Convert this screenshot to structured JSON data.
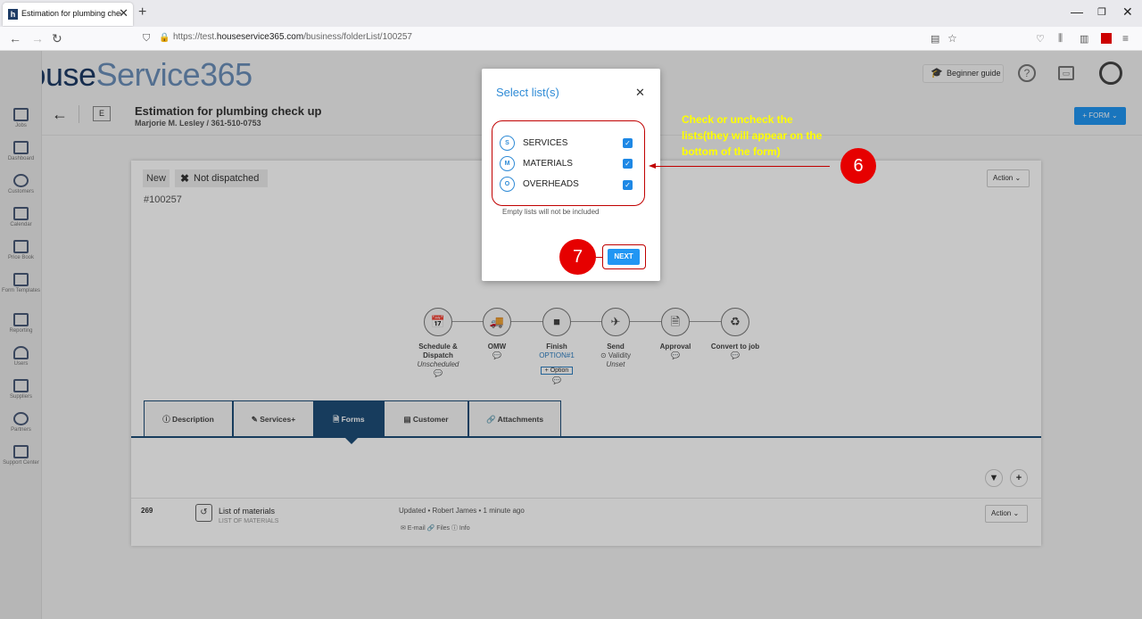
{
  "browser": {
    "tab_title": "Estimation for plumbing check",
    "tab_close": "✕",
    "new_tab": "+",
    "url_prefix": "https://test.",
    "url_domain": "houseservice365.com",
    "url_path": "/business/folderList/100257"
  },
  "app": {
    "logo_h": "House",
    "logo_s": "Service365",
    "beginner_guide": "Beginner guide",
    "sidebar": [
      {
        "label": "Jobs",
        "name": "jobs"
      },
      {
        "label": "Dashboard",
        "name": "dashboard"
      },
      {
        "label": "Customers",
        "name": "customers"
      },
      {
        "label": "Calendar",
        "name": "calendar"
      },
      {
        "label": "Price Book",
        "name": "price-book"
      },
      {
        "label": "Form Templates",
        "name": "form-templates"
      },
      {
        "label": "Reporting",
        "name": "reporting"
      },
      {
        "label": "Users",
        "name": "users"
      },
      {
        "label": "Suppliers",
        "name": "suppliers"
      },
      {
        "label": "Partners",
        "name": "partners"
      },
      {
        "label": "Support Center",
        "name": "support-center"
      }
    ]
  },
  "page": {
    "e_badge": "E",
    "title": "Estimation for plumbing check up",
    "subtitle": "Marjorie M. Lesley / 361-510-0753",
    "form_button": "+ FORM ⌄",
    "status_new": "New",
    "status_dispatch": "Not dispatched",
    "job_number": "#100257",
    "action": "Action ⌄"
  },
  "steps": [
    {
      "name": "Schedule & Dispatch",
      "sub": "Unscheduled",
      "icon": "📅"
    },
    {
      "name": "OMW",
      "sub": "",
      "icon": "🚚"
    },
    {
      "name": "Finish",
      "link": "OPTION#1",
      "opt": "+ Option",
      "icon": "■"
    },
    {
      "name": "Send",
      "sub_icon_text": "⊙ Validity",
      "sub": "Unset",
      "icon": "✈"
    },
    {
      "name": "Approval",
      "sub": "",
      "icon": "🗎"
    },
    {
      "name": "Convert to job",
      "sub": "",
      "icon": "♻"
    }
  ],
  "tabs": [
    {
      "label": "ⓘ  Description"
    },
    {
      "label": "✎  Services+"
    },
    {
      "label": "🗎  Forms"
    },
    {
      "label": "▤  Customer"
    },
    {
      "label": "🔗  Attachments"
    }
  ],
  "row": {
    "num": "269",
    "title": "List of materials",
    "sub": "LIST OF MATERIALS",
    "updated": "Updated • Robert James • 1 minute ago",
    "links": "✉ E-mail    🔗 Files    ⓘ Info",
    "action": "Action ⌄"
  },
  "modal": {
    "title": "Select list(s)",
    "close": "✕",
    "items": [
      {
        "badge": "S",
        "label": "SERVICES",
        "checked": true
      },
      {
        "badge": "M",
        "label": "MATERIALS",
        "checked": true
      },
      {
        "badge": "O",
        "label": "OVERHEADS",
        "checked": true
      }
    ],
    "note": "Empty lists will not be included",
    "next": "NEXT"
  },
  "annotations": {
    "step6": "6",
    "step7": "7",
    "callout": "Check or uncheck the lists(they will appear on the bottom of the form)",
    "colors": {
      "red": "#e60000",
      "callout": "#ffff00",
      "accent": "#2196f3"
    }
  }
}
